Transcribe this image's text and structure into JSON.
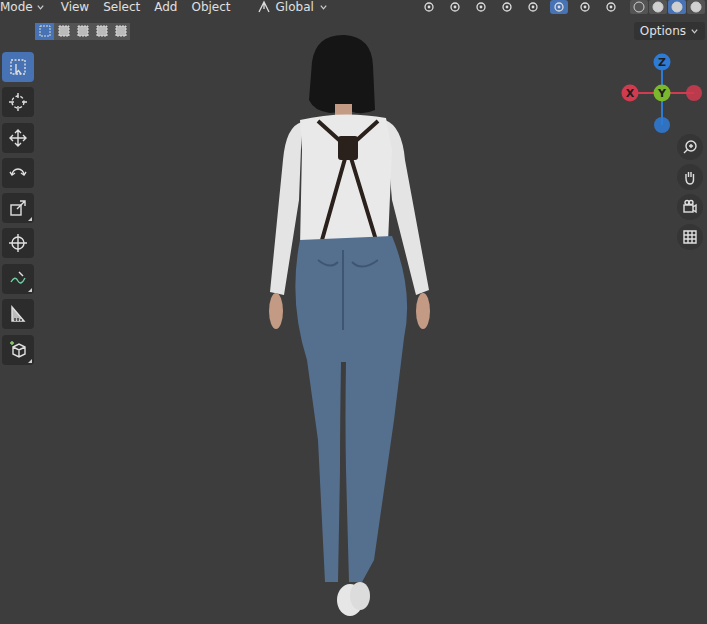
{
  "header": {
    "mode": "Mode",
    "menus": [
      "View",
      "Select",
      "Add",
      "Object"
    ],
    "orientation": "Global",
    "toggles": [
      {
        "kind": "pivot",
        "selected": false
      },
      {
        "kind": "snap",
        "selected": false
      },
      {
        "kind": "proportional",
        "selected": false
      },
      {
        "kind": "falloff",
        "selected": false
      },
      {
        "kind": "visibility",
        "selected": false
      },
      {
        "kind": "gizmo",
        "selected": true
      },
      {
        "kind": "overlay",
        "selected": false
      },
      {
        "kind": "xray",
        "selected": false
      }
    ]
  },
  "shading_modes": [
    {
      "kind": "wireframe",
      "selected": false
    },
    {
      "kind": "solid",
      "selected": false
    },
    {
      "kind": "material",
      "selected": true
    },
    {
      "kind": "rendered",
      "selected": false
    }
  ],
  "select_modes": [
    {
      "kind": "new",
      "selected": true
    },
    {
      "kind": "extend",
      "selected": false
    },
    {
      "kind": "subtract",
      "selected": false
    },
    {
      "kind": "invert",
      "selected": false
    },
    {
      "kind": "intersect",
      "selected": false
    }
  ],
  "options": {
    "label": "Options"
  },
  "toolbar": [
    {
      "tools": [
        {
          "kind": "select-box",
          "selected": true,
          "more": false
        },
        {
          "kind": "cursor",
          "selected": false,
          "more": false
        }
      ]
    },
    {
      "tools": [
        {
          "kind": "move",
          "selected": false,
          "more": false
        },
        {
          "kind": "rotate",
          "selected": false,
          "more": false
        },
        {
          "kind": "scale",
          "selected": false,
          "more": true
        },
        {
          "kind": "transform",
          "selected": false,
          "more": false
        }
      ]
    },
    {
      "tools": [
        {
          "kind": "annotate",
          "selected": false,
          "more": true
        },
        {
          "kind": "measure",
          "selected": false,
          "more": false
        }
      ]
    },
    {
      "tools": [
        {
          "kind": "add-cube",
          "selected": false,
          "more": true
        }
      ]
    }
  ],
  "gizmo": {
    "axes": [
      {
        "label": "Z",
        "color": "#2e7bd6"
      },
      {
        "label": "X",
        "color": "#d13b50"
      },
      {
        "label": "Y",
        "color": "#7ab82c"
      }
    ]
  },
  "nav_buttons": [
    {
      "kind": "zoom"
    },
    {
      "kind": "pan"
    },
    {
      "kind": "camera"
    },
    {
      "kind": "grid"
    }
  ]
}
